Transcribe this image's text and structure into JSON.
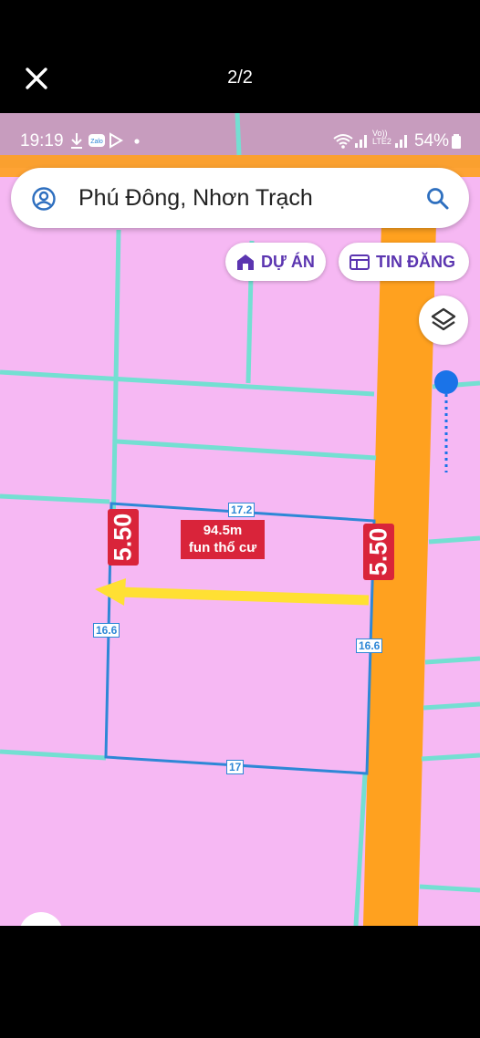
{
  "viewer": {
    "counter": "2/2"
  },
  "status_bar": {
    "time": "19:19",
    "carrier": "Vo)) LTE2",
    "battery": "54%"
  },
  "search": {
    "query": "Phú Đông, Nhơn Trạch"
  },
  "chips": {
    "du_an": "DỰ ÁN",
    "tin_dang": "TIN ĐĂNG"
  },
  "plot": {
    "width_left": "5.50",
    "width_right": "5.50",
    "area_line1": "94.5m",
    "area_line2": "fun thổ cư",
    "top_edge": "17.2",
    "bottom_edge": "17",
    "left_edge": "16.6",
    "right_edge": "16.6"
  },
  "colors": {
    "land": "#f6b8f3",
    "road": "#ffa11f",
    "parcel_line": "#74dfd2",
    "plot_outline": "#2e87d6",
    "label_red": "#d9243a",
    "arrow": "#ffe033",
    "chip_text": "#5b35b0",
    "slider": "#1a73e8"
  },
  "icons": [
    "close-icon",
    "user-icon",
    "search-icon",
    "building-icon",
    "list-icon",
    "layers-icon",
    "download-icon",
    "zalo-icon",
    "play-icon",
    "wifi-icon",
    "signal-icon",
    "battery-icon"
  ]
}
